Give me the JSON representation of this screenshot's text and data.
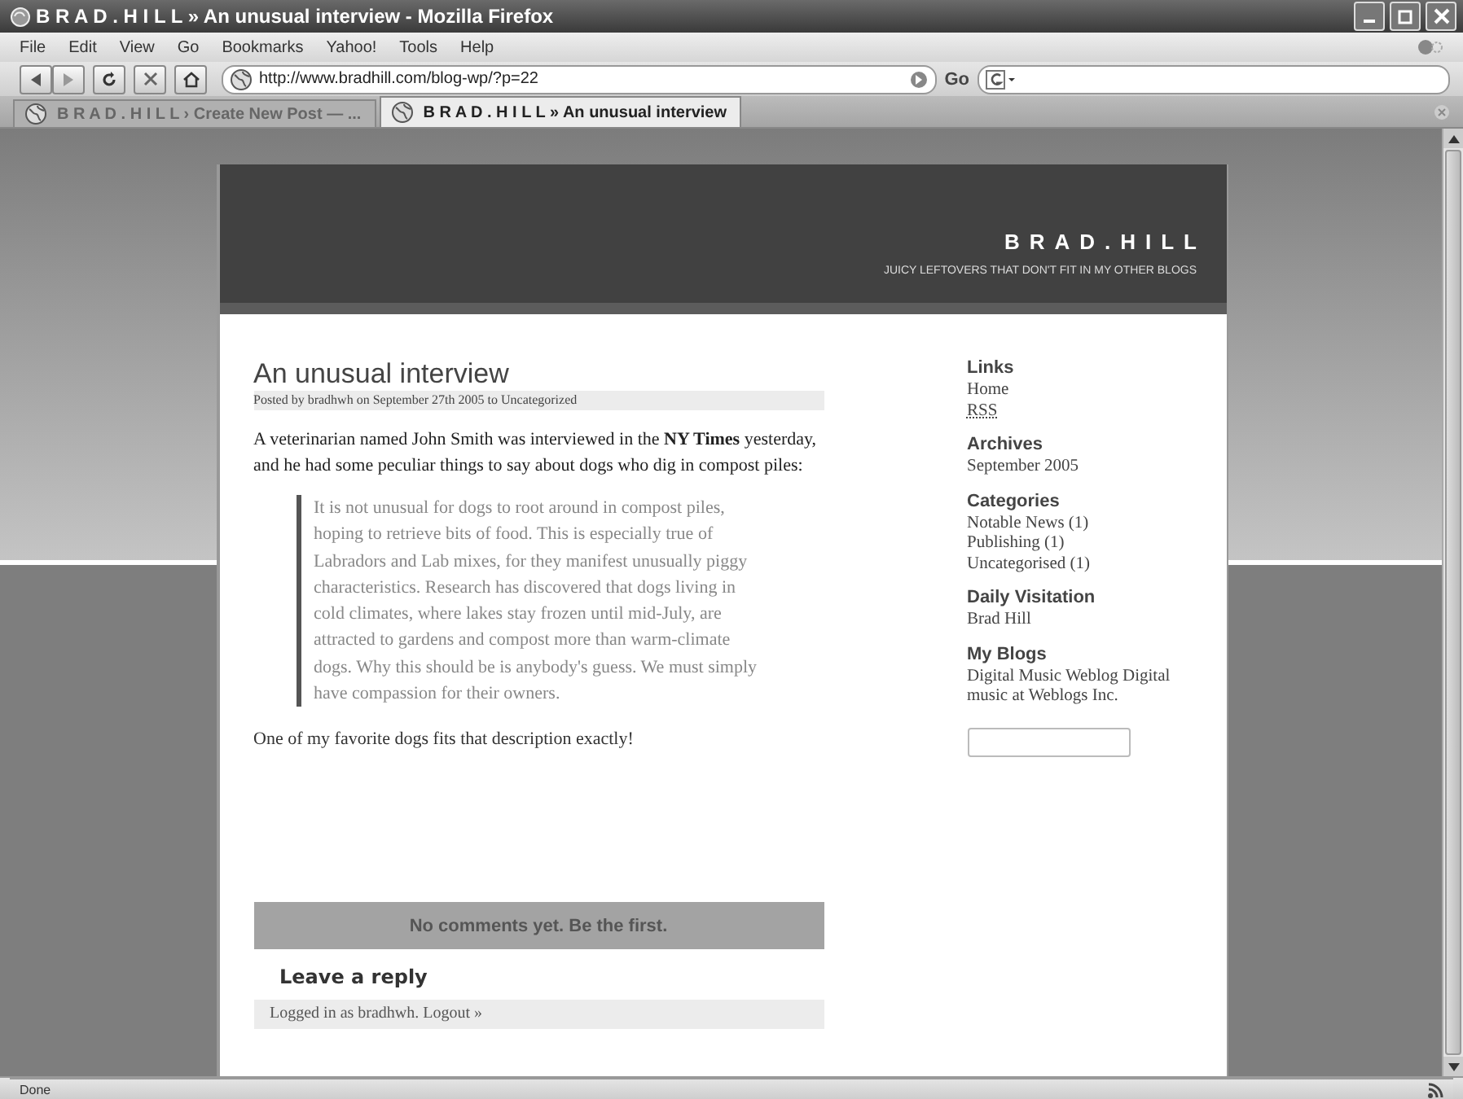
{
  "window": {
    "title": "B R A D . H I L L » An unusual interview - Mozilla Firefox"
  },
  "menu": [
    {
      "label": "File"
    },
    {
      "label": "Edit"
    },
    {
      "label": "View"
    },
    {
      "label": "Go"
    },
    {
      "label": "Bookmarks"
    },
    {
      "label": "Yahoo!"
    },
    {
      "label": "Tools"
    },
    {
      "label": "Help"
    }
  ],
  "toolbar": {
    "address": "http://www.bradhill.com/blog-wp/?p=22",
    "go_label": "Go"
  },
  "tabs": [
    {
      "label": "B R A D . H I L L › Create New Post — ...",
      "selected": false
    },
    {
      "label": "B R A D . H I L L » An unusual interview",
      "selected": true
    }
  ],
  "blog": {
    "title": "BRAD.HILL",
    "tagline": "JUICY LEFTOVERS THAT DON'T FIT IN MY OTHER BLOGS"
  },
  "post": {
    "title": "An unusual interview",
    "meta": "Posted by bradhwh on September 27th 2005 to Uncategorized",
    "intro": "A veterinarian named John Smith was interviewed in the **NY Times** yesterday, and he had some peculiar things to say about dogs who dig in compost piles:",
    "quote": "It is not unusual for dogs to root around in compost piles, hoping to retrieve bits of food. This is especially true of Labradors and Lab mixes, for they manifest unusually piggy characteristics. Research has discovered that dogs living in cold climates, where lakes stay frozen until mid-July, are attracted to gardens and compost more than warm-climate dogs. Why this should be is anybody's guess. We must simply have compassion for their owners.",
    "closing": "One of my favorite dogs fits that description exactly!",
    "comments_banner": "No comments yet. Be the first.",
    "reply_heading": "Leave a reply",
    "logged_in": "Logged in as bradhwh. Logout »"
  },
  "sidebar": [
    {
      "heading": "Links",
      "items": [
        "Home",
        "RSS"
      ]
    },
    {
      "heading": "Archives",
      "items": [
        "September 2005"
      ]
    },
    {
      "heading": "Categories",
      "items": [
        "Notable News (1)",
        "Publishing (1)",
        "Uncategorised (1)"
      ]
    },
    {
      "heading": "Daily Visitation",
      "items": [
        "Brad Hill"
      ]
    },
    {
      "heading": "My Blogs",
      "items": [
        "Digital Music Weblog Digital music at Weblogs Inc."
      ]
    }
  ],
  "status_bar": {
    "text": "Done"
  }
}
